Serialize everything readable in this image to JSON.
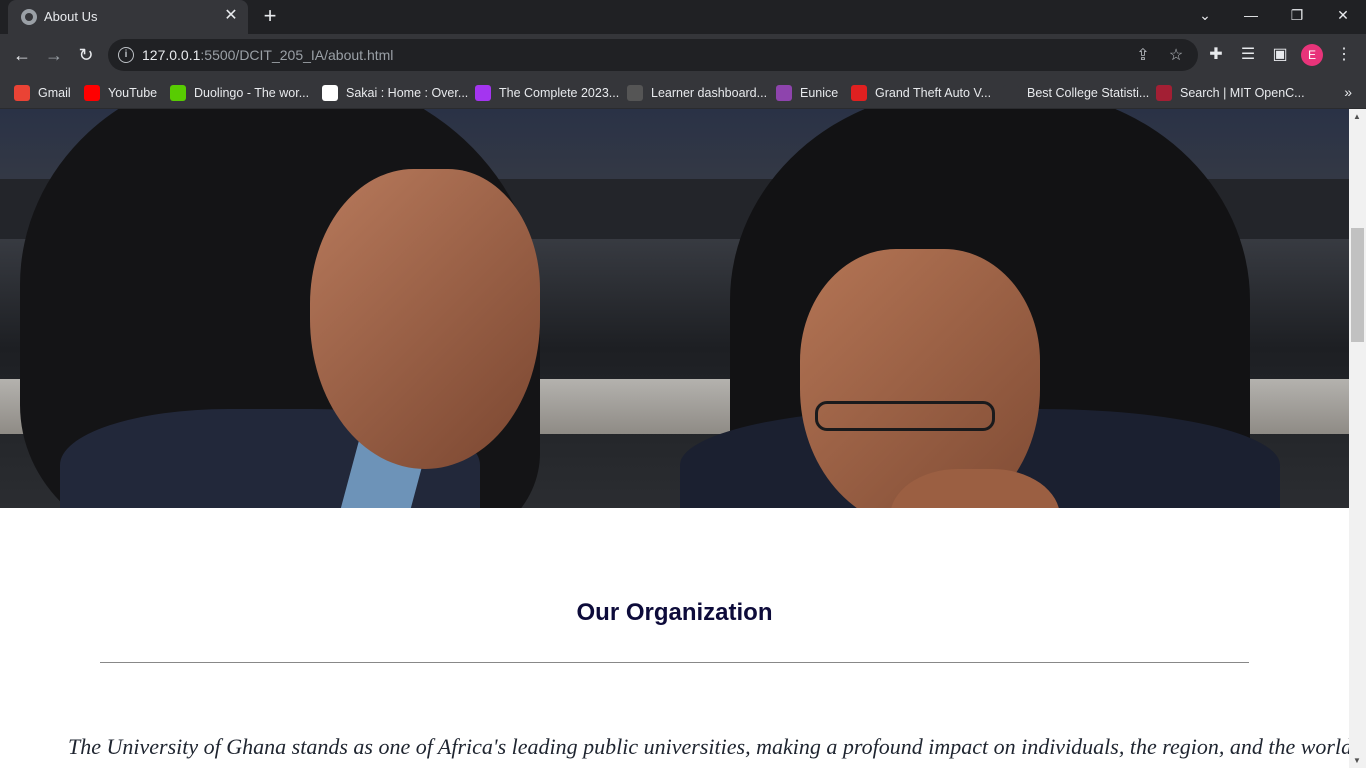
{
  "browser": {
    "tab_title": "About Us",
    "tab_close": "✕",
    "new_tab": "+",
    "window_controls": {
      "chevron": "⌄",
      "minimize": "—",
      "restore": "❐",
      "close": "✕"
    },
    "nav": {
      "back": "←",
      "forward": "→",
      "reload": "↻"
    },
    "address": {
      "host": "127.0.0.1",
      "rest": ":5500/DCIT_205_IA/about.html"
    },
    "omnibox_icons": {
      "share": "⇪",
      "bookmark": "☆"
    },
    "toolbar_icons": {
      "extensions": "✚",
      "reading_list": "☰",
      "side_panel": "▣",
      "menu": "⋮"
    },
    "profile_initial": "E",
    "bookmarks": [
      {
        "label": "Gmail",
        "icon": "gmail-icon",
        "color": "#ea4335"
      },
      {
        "label": "YouTube",
        "icon": "youtube-icon",
        "color": "#ff0000"
      },
      {
        "label": "Duolingo - The wor...",
        "icon": "duolingo-icon",
        "color": "#58cc02"
      },
      {
        "label": "Sakai : Home : Over...",
        "icon": "sakai-icon",
        "color": "#ffffff"
      },
      {
        "label": "The Complete 2023...",
        "icon": "udemy-icon",
        "color": "#a435f0"
      },
      {
        "label": "Learner dashboard...",
        "icon": "alx-icon",
        "color": "#555555"
      },
      {
        "label": "Eunice",
        "icon": "chrome-profile-icon",
        "color": "#8e44ad"
      },
      {
        "label": "Grand Theft Auto V...",
        "icon": "gta-icon",
        "color": "#e02020"
      },
      {
        "label": "Best College Statisti...",
        "icon": "page-icon",
        "color": "#35363a"
      },
      {
        "label": "Search | MIT OpenC...",
        "icon": "mit-ocw-icon",
        "color": "#a31f34"
      }
    ],
    "bookmarks_overflow": "»"
  },
  "page": {
    "hero_image": "students-studying-photo",
    "section_title": "Our Organization",
    "paragraph": "The University of Ghana stands as one of Africa's leading public universities, making a profound impact on individuals, the region, and the world."
  },
  "scrollbar": {
    "up": "▲",
    "down": "▼"
  }
}
